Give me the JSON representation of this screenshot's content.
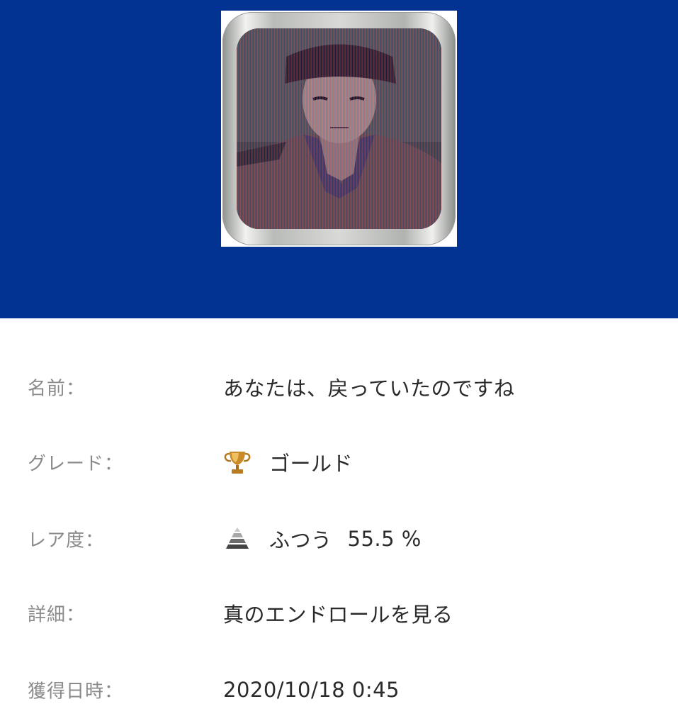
{
  "header": {
    "background_color": "#023393",
    "trophy_image": "trophy-portrait-image"
  },
  "details": {
    "name": {
      "label": "名前：",
      "value": "あなたは、戻っていたのですね"
    },
    "grade": {
      "label": "グレード：",
      "icon": "gold-trophy-icon",
      "value": "ゴールド"
    },
    "rarity": {
      "label": "レア度：",
      "icon": "rarity-pyramid-icon",
      "value": "ふつう",
      "percent": "55.5 %"
    },
    "detail": {
      "label": "詳細：",
      "value": "真のエンドロールを見る"
    },
    "earned": {
      "label": "獲得日時：",
      "value": "2020/10/18 0:45"
    }
  }
}
